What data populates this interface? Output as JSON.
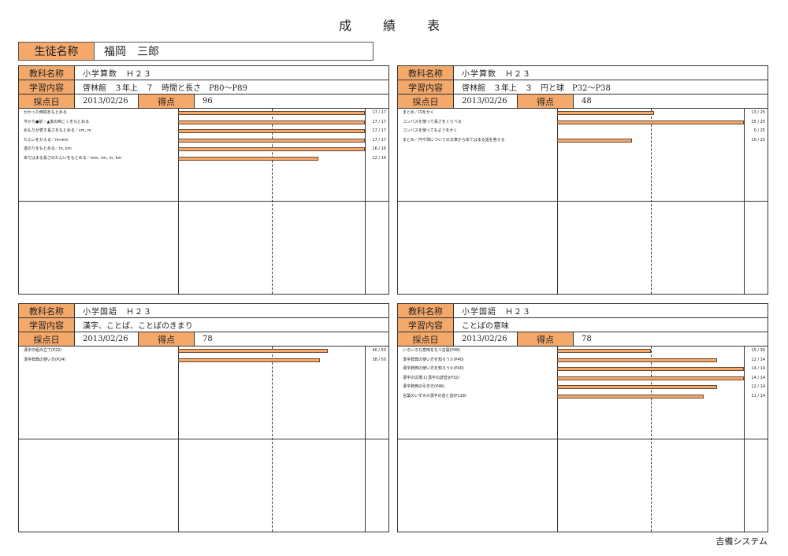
{
  "title": "成　績　表",
  "student": {
    "label": "生徒名称",
    "name": "福岡　三郎"
  },
  "footer": "吉備システム",
  "panel_labels": {
    "subject": "教科名称",
    "content": "学習内容",
    "date": "採点日",
    "score": "得点"
  },
  "colors": {
    "accent": "#f4a96b",
    "bar_border": "#6a4630"
  },
  "panels": [
    {
      "subject": "小学算数　Ｈ２３",
      "content": "啓林館　３年上　７　時間と長さ　P80～P89",
      "date": "2013/02/26",
      "score": "96",
      "items": [
        {
          "label": "かかった時間をもとめる",
          "got": 17,
          "max": 17,
          "score_text": "17 / 17"
        },
        {
          "label": "今から●前・▲後の時こくをもとめる",
          "got": 17,
          "max": 17,
          "score_text": "17 / 17"
        },
        {
          "label": "めもりが表す長さをもとめる／cm, m",
          "got": 17,
          "max": 17,
          "score_text": "17 / 17"
        },
        {
          "label": "たんいをかえる／m⇔km",
          "got": 17,
          "max": 17,
          "score_text": "17 / 17"
        },
        {
          "label": "道のりをもとめる／m, km",
          "got": 16,
          "max": 16,
          "score_text": "16 / 16"
        },
        {
          "label": "あてはまる長さのたんいをもとめる／mm, cm, m, km",
          "got": 12,
          "max": 16,
          "score_text": "12 / 16"
        }
      ]
    },
    {
      "subject": "小学算数　Ｈ２３",
      "content": "啓林館　３年上　３　円と球　P32～P38",
      "date": "2013/02/26",
      "score": "48",
      "items": [
        {
          "label": "まとめ／円をかく",
          "got": 13,
          "max": 25,
          "score_text": "13 / 25"
        },
        {
          "label": "コンパスを使って長さをくらべる",
          "got": 25,
          "max": 25,
          "score_text": "25 / 25"
        },
        {
          "label": "コンパスを使ってもようをかく",
          "got": 0,
          "max": 25,
          "score_text": "0 / 25"
        },
        {
          "label": "まとめ／円や球についての文章からあてはまる語を答える",
          "got": 10,
          "max": 25,
          "score_text": "10 / 25"
        }
      ]
    },
    {
      "subject": "小学国語　Ｈ２３",
      "content": "漢字、ことば、ことばのきまり",
      "date": "2013/02/26",
      "score": "78",
      "items": [
        {
          "label": "漢字の組み立て(P22)",
          "got": 40,
          "max": 50,
          "score_text": "40 / 50"
        },
        {
          "label": "漢字辞典の使い方(P24)",
          "got": 38,
          "max": 50,
          "score_text": "38 / 50"
        }
      ]
    },
    {
      "subject": "小学国語　Ｈ２３",
      "content": "ことばの意味",
      "date": "2013/02/26",
      "score": "78",
      "items": [
        {
          "label": "いろいろな意味をもつ言葉(P48)",
          "got": 15,
          "max": 30,
          "score_text": "15 / 30"
        },
        {
          "label": "漢字辞典の使い方を知ろう①(P40)",
          "got": 12,
          "max": 14,
          "score_text": "12 / 14"
        },
        {
          "label": "漢字辞典の使い方を知ろう②(P40)",
          "got": 14,
          "max": 14,
          "score_text": "14 / 14"
        },
        {
          "label": "漢字の広場１[漢字の読音](P32)",
          "got": 14,
          "max": 14,
          "score_text": "14 / 14"
        },
        {
          "label": "漢字辞典の引き方(P46)",
          "got": 12,
          "max": 14,
          "score_text": "12 / 14"
        },
        {
          "label": "言葉のいずみ②漢字の音と訓(P118)",
          "got": 11,
          "max": 14,
          "score_text": "11 / 14"
        }
      ]
    }
  ]
}
